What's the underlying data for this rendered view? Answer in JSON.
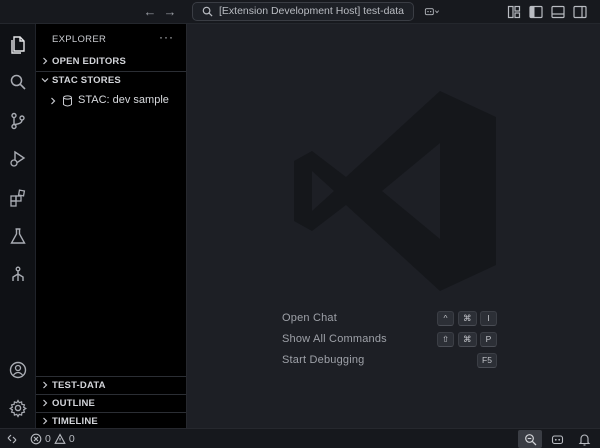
{
  "window": {
    "command_center_text": "[Extension Development Host] test-data"
  },
  "activity_bar": {
    "items": [
      {
        "name": "explorer",
        "icon": "files-icon"
      },
      {
        "name": "search",
        "icon": "search-icon"
      },
      {
        "name": "source-control",
        "icon": "source-control-icon"
      },
      {
        "name": "run-and-debug",
        "icon": "run-debug-icon"
      },
      {
        "name": "extensions",
        "icon": "extensions-icon"
      },
      {
        "name": "testing",
        "icon": "beaker-icon"
      },
      {
        "name": "stac",
        "icon": "tree-icon"
      }
    ],
    "bottom": [
      {
        "name": "accounts",
        "icon": "account-icon"
      },
      {
        "name": "manage",
        "icon": "gear-icon"
      }
    ]
  },
  "sidebar": {
    "title": "EXPLORER",
    "more": "···",
    "sections": {
      "open_editors": "OPEN EDITORS",
      "stac_stores": "STAC STORES",
      "test_data": "TEST-DATA",
      "outline": "OUTLINE",
      "timeline": "TIMELINE"
    },
    "stac_item": "STAC: dev sample"
  },
  "editor": {
    "hints": [
      {
        "label": "Open Chat",
        "keys": [
          "^",
          "⌘",
          "I"
        ]
      },
      {
        "label": "Show All Commands",
        "keys": [
          "⇧",
          "⌘",
          "P"
        ]
      },
      {
        "label": "Start Debugging",
        "keys": [
          "F5"
        ]
      }
    ]
  },
  "status_bar": {
    "errors": "0",
    "warnings": "0"
  },
  "colors": {
    "editor_bg": "#1d1f25",
    "sidebar_bg": "#000000",
    "activity_bg": "#0f1115",
    "title_bg": "#17191e"
  }
}
